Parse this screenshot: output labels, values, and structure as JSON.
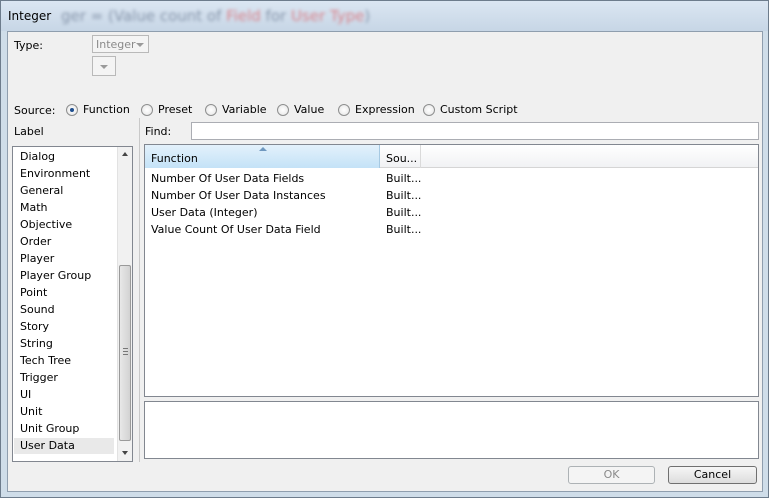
{
  "window": {
    "title": "Integer",
    "blurred_title_parts": [
      "ger = (",
      "Value count of ",
      "Field",
      " for ",
      "User Type",
      ")"
    ]
  },
  "type_row": {
    "label": "Type:",
    "type_value": "Integer",
    "sub_value": ""
  },
  "source": {
    "label": "Source:",
    "options": [
      {
        "label": "Function",
        "selected": true
      },
      {
        "label": "Preset",
        "selected": false
      },
      {
        "label": "Variable",
        "selected": false
      },
      {
        "label": "Value",
        "selected": false
      },
      {
        "label": "Expression",
        "selected": false
      },
      {
        "label": "Custom Script",
        "selected": false
      }
    ]
  },
  "label_panel": {
    "heading": "Label",
    "items": [
      "Dialog",
      "Environment",
      "General",
      "Math",
      "Objective",
      "Order",
      "Player",
      "Player Group",
      "Point",
      "Sound",
      "Story",
      "String",
      "Tech Tree",
      "Trigger",
      "UI",
      "Unit",
      "Unit Group",
      "User Data"
    ],
    "selected": "User Data"
  },
  "find": {
    "label": "Find:",
    "value": ""
  },
  "functions_table": {
    "columns": [
      "Function",
      "Sou..."
    ],
    "sorted_column": "Function",
    "rows": [
      {
        "function": "Number Of User Data Fields",
        "source": "Built..."
      },
      {
        "function": "Number Of User Data Instances",
        "source": "Built..."
      },
      {
        "function": "User Data (Integer)",
        "source": "Built..."
      },
      {
        "function": "Value Count Of User Data Field",
        "source": "Built..."
      }
    ]
  },
  "description": "",
  "buttons": {
    "ok": "OK",
    "cancel": "Cancel"
  },
  "colors": {
    "window_frame": "#cfdde9",
    "client_bg": "#f0f0f0",
    "header_selected": "#c4e2f7",
    "selected_item": "#e9e9e9"
  }
}
